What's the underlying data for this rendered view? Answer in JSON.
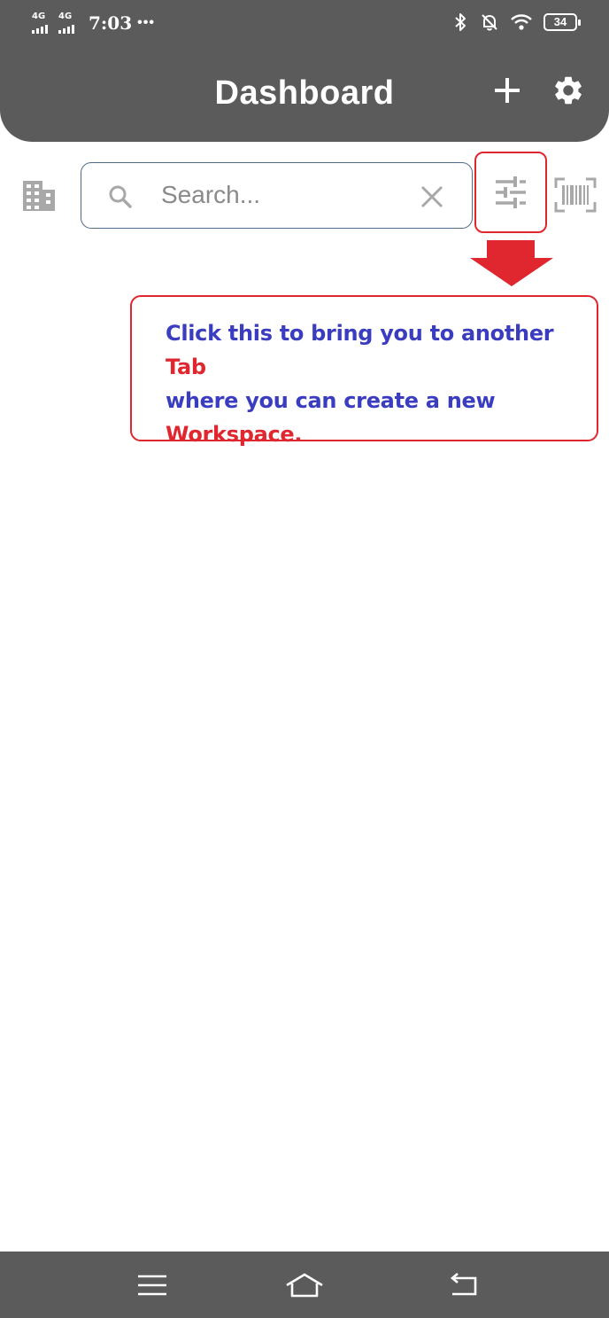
{
  "status_bar": {
    "network_1": "4G",
    "network_2": "4G",
    "time": "7:03",
    "more": "•••",
    "battery": "34",
    "icons": [
      "bluetooth-icon",
      "bell-off-icon",
      "wifi-icon",
      "battery-icon"
    ]
  },
  "header": {
    "title": "Dashboard",
    "actions": [
      "add-icon",
      "gear-icon"
    ],
    "background": "#5b5b5b"
  },
  "toolbar": {
    "search_placeholder": "Search...",
    "icons": [
      "building-icon",
      "search-icon",
      "close-icon",
      "sliders-icon",
      "barcode-scan-icon"
    ]
  },
  "annotation": {
    "line1_a": "Click this to bring you to another ",
    "line1_b": "Tab",
    "line2": "where you can create a new",
    "line3": "Workspace.",
    "text_color": "#3b3dc0",
    "highlight_color": "#e0262e"
  },
  "nav_bar": {
    "icons": [
      "menu-icon",
      "home-icon",
      "back-icon"
    ]
  }
}
